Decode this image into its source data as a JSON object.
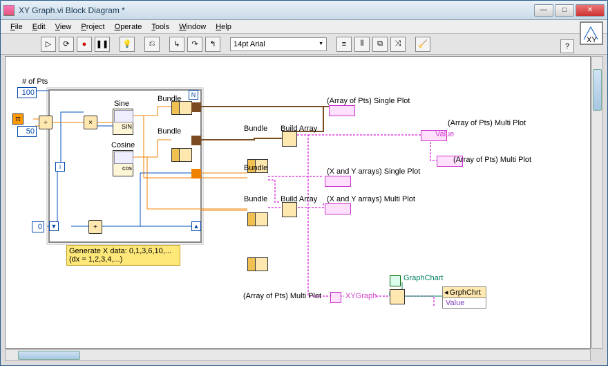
{
  "window": {
    "title": "XY Graph.vi Block Diagram *"
  },
  "menu": {
    "file": "File",
    "edit": "Edit",
    "view": "View",
    "project": "Project",
    "operate": "Operate",
    "tools": "Tools",
    "window": "Window",
    "help": "Help"
  },
  "toolbar": {
    "font": "14pt Arial"
  },
  "icon": {
    "text": "XY"
  },
  "diagram": {
    "numpts_label": "# of Pts",
    "numpts_value": "100",
    "fifty": "50",
    "zero": "0",
    "i": "i",
    "N": "N",
    "pi": "π",
    "sine": "Sine",
    "sine_sub": "SIN",
    "cosine": "Cosine",
    "cosine_sub": "cos",
    "bundle": "Bundle",
    "buildarray": "Build Array",
    "single1": "(Array of Pts) Single Plot",
    "multi1": "(Array of Pts) Multi Plot",
    "value": "Value",
    "multi1b": "(Array of Pts) Multi Plot",
    "single2": "(X and Y arrays) Single Plot",
    "multi2": "(X and Y arrays) Multi Plot",
    "graphchart": "GraphChart",
    "xygraph": "XYGraph",
    "grphchrt": "GrphChrt",
    "value2": "Value",
    "multi1c": "(Array of Pts) Multi Plot",
    "comment_l1": "Generate X data:  0,1,3,6,10,...",
    "comment_l2": "(dx = 1,2,3,4,...)"
  }
}
